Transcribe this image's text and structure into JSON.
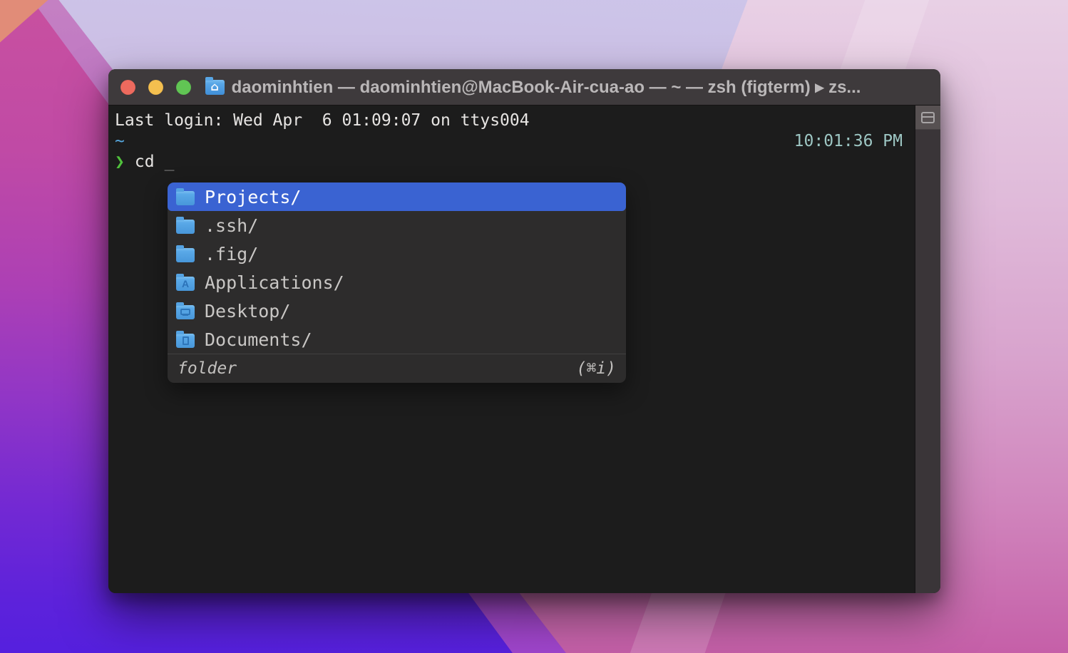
{
  "window": {
    "title": "daominhtien — daominhtien@MacBook-Air-cua-ao — ~ — zsh (figterm) ▸ zs...",
    "proxy_icon": "home-folder-icon",
    "proxy_glyph": "⌂",
    "traffic_buttons": [
      "close",
      "minimize",
      "zoom"
    ]
  },
  "terminal": {
    "last_login": "Last login: Wed Apr  6 01:09:07 on ttys004",
    "cwd": "~",
    "clock": "10:01:36 PM",
    "prompt_symbol": "❯",
    "command": "cd",
    "cursor": "_"
  },
  "autocomplete": {
    "items": [
      {
        "label": "Projects/",
        "glyph": "plain",
        "icon_name": "folder-icon",
        "selected": true
      },
      {
        "label": ".ssh/",
        "glyph": "plain",
        "icon_name": "folder-icon",
        "selected": false
      },
      {
        "label": ".fig/",
        "glyph": "plain",
        "icon_name": "folder-icon",
        "selected": false
      },
      {
        "label": "Applications/",
        "glyph": "app",
        "icon_name": "applications-folder-icon",
        "selected": false
      },
      {
        "label": "Desktop/",
        "glyph": "desktop",
        "icon_name": "desktop-folder-icon",
        "selected": false
      },
      {
        "label": "Documents/",
        "glyph": "doc",
        "icon_name": "documents-folder-icon",
        "selected": false
      }
    ],
    "footer": {
      "type_label": "folder",
      "shortcut": "(⌘i)"
    }
  },
  "scrollbar": {
    "split_icon": "split-pane-icon"
  },
  "colors": {
    "accent": "#3a63d2",
    "prompt": "#50c23c",
    "tilde": "#57a9e0",
    "clock": "#9dc6c3",
    "folder-blue": "#58a6e6",
    "traffic-red": "#ed6a5e",
    "traffic-yellow": "#f4bf4f",
    "traffic-green": "#61c554"
  }
}
